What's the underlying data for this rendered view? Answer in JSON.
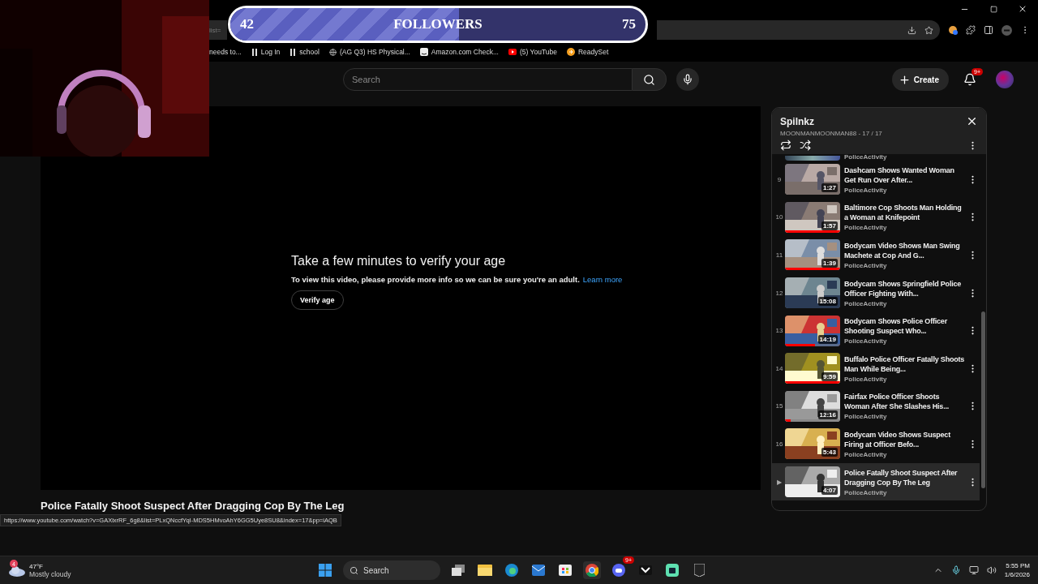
{
  "stream_overlay": {
    "followers": {
      "current": "42",
      "label": "FOLLOWERS",
      "goal": "75",
      "level": 0.55
    }
  },
  "browser": {
    "address_fragment": "list=",
    "bookmarks": [
      {
        "label": "needs to...",
        "kind": "none"
      },
      {
        "label": "Log In",
        "kind": "grid"
      },
      {
        "label": "school",
        "kind": "grid"
      },
      {
        "label": "(AG Q3) HS Physical...",
        "kind": "globe"
      },
      {
        "label": "Amazon.com Check...",
        "kind": "amazon"
      },
      {
        "label": "(5) YouTube",
        "kind": "youtube"
      },
      {
        "label": "ReadySet",
        "kind": "readyset"
      }
    ]
  },
  "youtube_header": {
    "search": {
      "placeholder": "Search"
    },
    "create_label": "Create",
    "notification_badge": "9+"
  },
  "player": {
    "heading": "Take a few minutes to verify your age",
    "message": "To view this video, please provide more info so we can be sure you're an adult.",
    "link": "Learn more",
    "button": "Verify age"
  },
  "video_title": "Police Fatally Shoot Suspect After Dragging Cop By The Leg",
  "playlist": {
    "title": "Spilnkz",
    "meta": "MOONMANMOONMAN88 - 17 / 17",
    "clipped_channel": "PoliceActivity",
    "items": [
      {
        "index": "9",
        "title": "Dashcam Shows Wanted Woman Get Run Over After...",
        "channel": "PoliceActivity",
        "duration": "1:27",
        "selected": false
      },
      {
        "index": "10",
        "title": "Baltimore Cop Shoots Man Holding a Woman at Knifepoint",
        "channel": "PoliceActivity",
        "duration": "1:57",
        "level": 1,
        "selected": false
      },
      {
        "index": "11",
        "title": "Bodycam Video Shows Man Swing Machete at Cop And G...",
        "channel": "PoliceActivity",
        "duration": "1:39",
        "level": 1,
        "selected": false
      },
      {
        "index": "12",
        "title": "Bodycam Shows Springfield Police Officer Fighting With...",
        "channel": "PoliceActivity",
        "duration": "15:08",
        "selected": false
      },
      {
        "index": "13",
        "title": "Bodycam Shows Police Officer Shooting Suspect Who...",
        "channel": "PoliceActivity",
        "duration": "14:19",
        "level": 0.55,
        "selected": false
      },
      {
        "index": "14",
        "title": "Buffalo Police Officer Fatally Shoots Man While Being...",
        "channel": "PoliceActivity",
        "duration": "9:59",
        "level": 1,
        "selected": false
      },
      {
        "index": "15",
        "title": "Fairfax Police Officer Shoots Woman After She Slashes His...",
        "channel": "PoliceActivity",
        "duration": "12:16",
        "level": 0.1,
        "selected": false
      },
      {
        "index": "16",
        "title": "Bodycam Video Shows Suspect Firing at Officer Befo...",
        "channel": "PoliceActivity",
        "duration": "5:43",
        "selected": false
      },
      {
        "index": "▶",
        "title": "Police Fatally Shoot Suspect After Dragging Cop By The Leg",
        "channel": "PoliceActivity",
        "duration": "4:07",
        "selected": true
      }
    ]
  },
  "status_url": "https://www.youtube.com/watch?v=GAXlxrRF_6g8&list=PLxQNccfYqI-MDS5HMvoAhY6GG5Uye8SU8&index=17&pp=iAQB",
  "taskbar": {
    "weather": {
      "badge": "4",
      "temperature": "47°F",
      "condition": "Mostly cloudy"
    },
    "search_label": "Search",
    "discord_badge": "9+",
    "time": "5:55 PM",
    "date": "1/6/2026"
  }
}
